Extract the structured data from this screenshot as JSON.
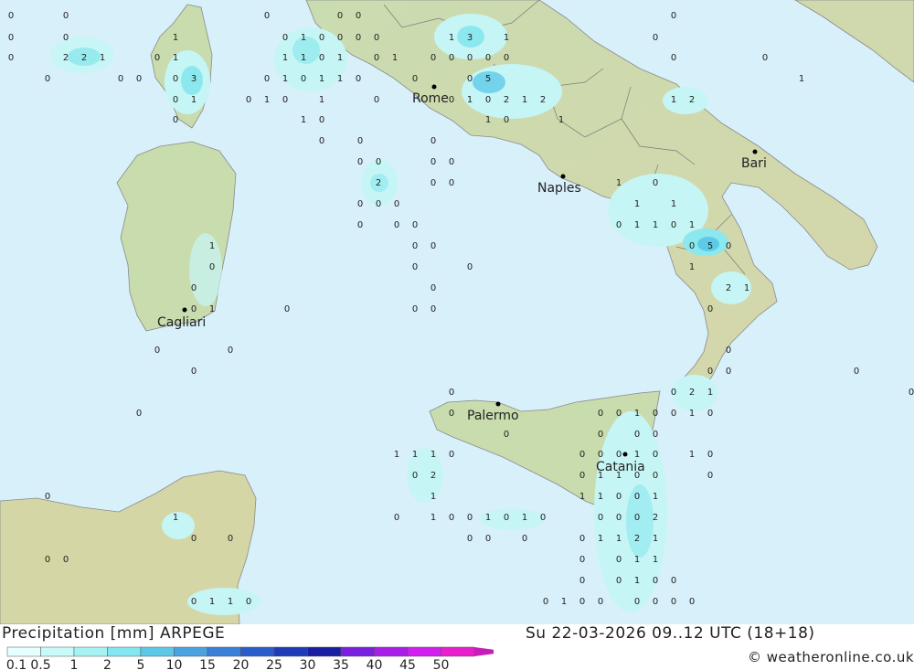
{
  "cities": [
    {
      "name": "Rome"
    },
    {
      "name": "Naples"
    },
    {
      "name": "Bari"
    },
    {
      "name": "Cagliari"
    },
    {
      "name": "Palermo"
    },
    {
      "name": "Catania"
    }
  ],
  "values": [
    "0",
    "1",
    "2",
    "3",
    "5"
  ],
  "footer": {
    "title": "Precipitation [mm] ARPEGE",
    "datetime": "Su 22-03-2026 09..12 UTC (18+18)",
    "credit": "© weatheronline.co.uk"
  },
  "legend": {
    "labels": [
      "0.1",
      "0.5",
      "1",
      "2",
      "5",
      "10",
      "15",
      "20",
      "25",
      "30",
      "35",
      "40",
      "45",
      "50"
    ],
    "colors": [
      "#e6ffff",
      "#c9fafa",
      "#a7f3f3",
      "#84e6f0",
      "#5ec8e8",
      "#4aa3e0",
      "#3a7fd8",
      "#2a5ccc",
      "#1f3cb8",
      "#1a1ea0",
      "#7a1ee0",
      "#a81ee8",
      "#d21ef0",
      "#e81ecc",
      "#c81eb8"
    ]
  },
  "colors": {
    "sea": "#d8f0fa",
    "land": "#c8dcae",
    "precip_light": "#c6f5f5",
    "precip_mid": "#8be8ee",
    "precip_strong": "#5ccbe8"
  }
}
